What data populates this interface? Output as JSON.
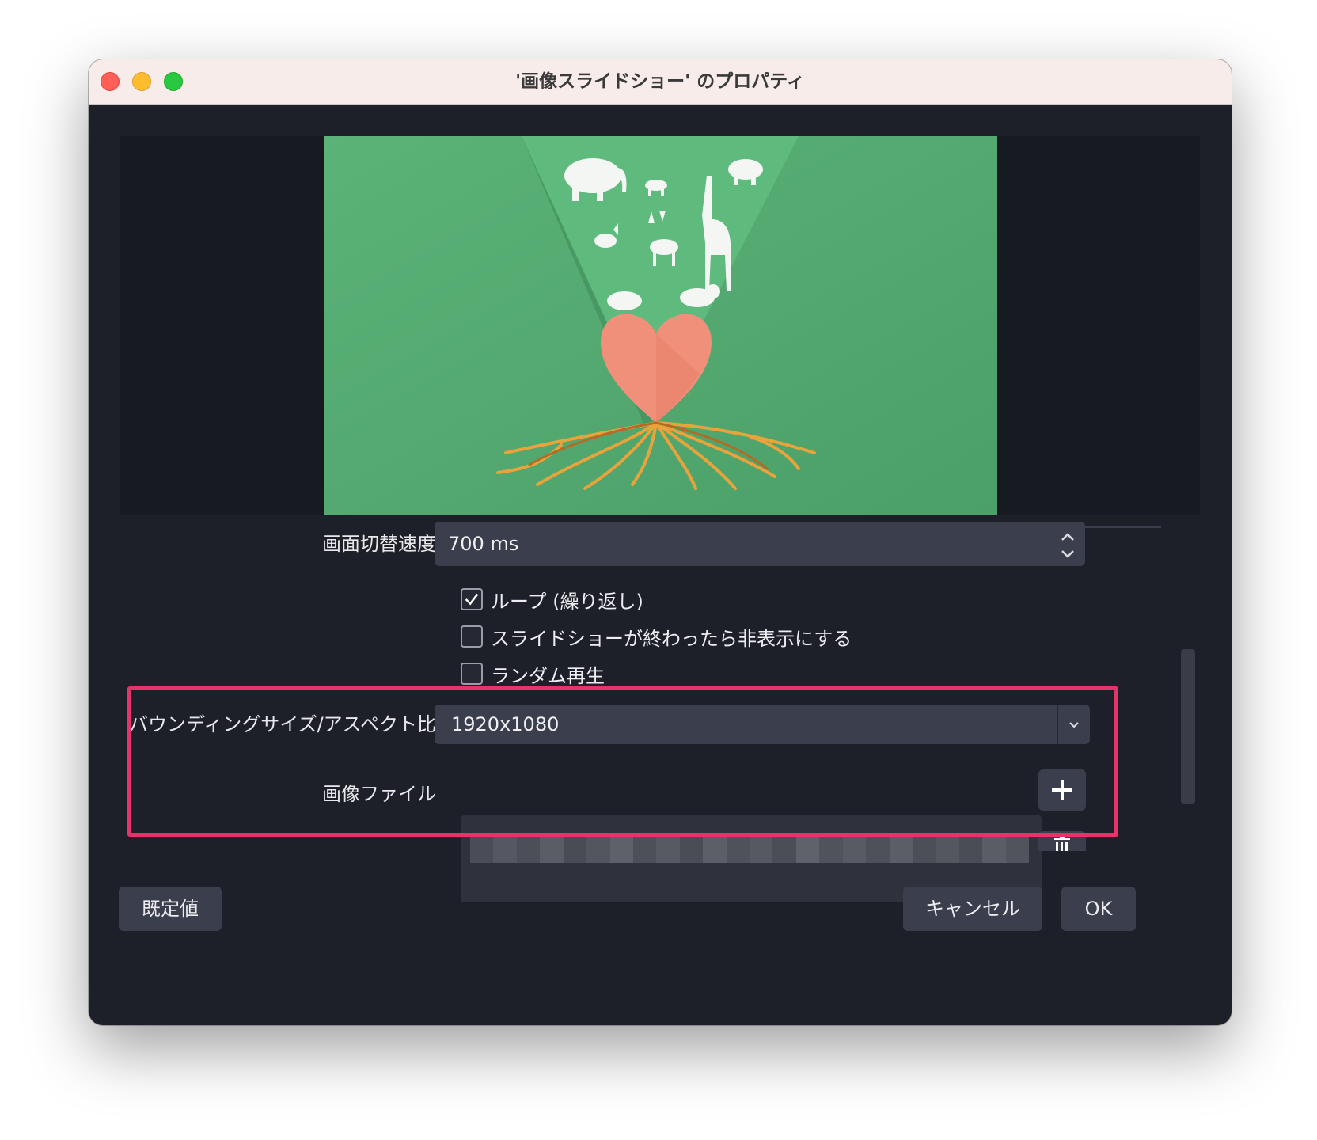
{
  "window": {
    "title": "'画像スライドショー' のプロパティ"
  },
  "preview": {
    "description_icon": "slideshow-preview-image"
  },
  "transition_speed": {
    "label": "画面切替速度",
    "value": "700 ms"
  },
  "options": {
    "loop": {
      "label": "ループ (繰り返し)",
      "checked": true
    },
    "hide_when_done": {
      "label": "スライドショーが終わったら非表示にする",
      "checked": false
    },
    "random": {
      "label": "ランダム再生",
      "checked": false
    }
  },
  "bounding_size": {
    "label": "バウンディングサイズ/アスペクト比",
    "value": "1920x1080"
  },
  "image_files": {
    "label": "画像ファイル"
  },
  "buttons": {
    "defaults": "既定値",
    "cancel": "キャンセル",
    "ok": "OK"
  },
  "colors": {
    "highlight": "#e8336a",
    "window_bg": "#1e2029",
    "field_bg": "#3b3e4c",
    "preview_green": "#55ad72"
  }
}
